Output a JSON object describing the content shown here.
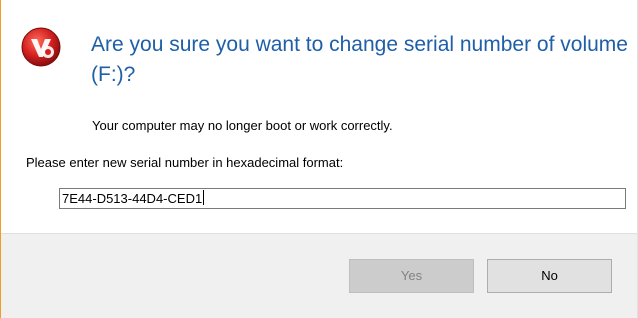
{
  "dialog": {
    "heading": "Are you sure you want to change serial number of volume (F:)?",
    "warning": "Your computer may no longer boot or work correctly.",
    "prompt": "Please enter new serial number in hexadecimal format:",
    "serial_value": "7E44-D513-44D4-CED1",
    "icon": "app-logo-icon"
  },
  "buttons": {
    "yes_label": "Yes",
    "no_label": "No",
    "yes_enabled": false
  },
  "colors": {
    "heading": "#1e5fa8",
    "footer_bg": "#f0f0f0",
    "icon_red": "#d22020"
  }
}
